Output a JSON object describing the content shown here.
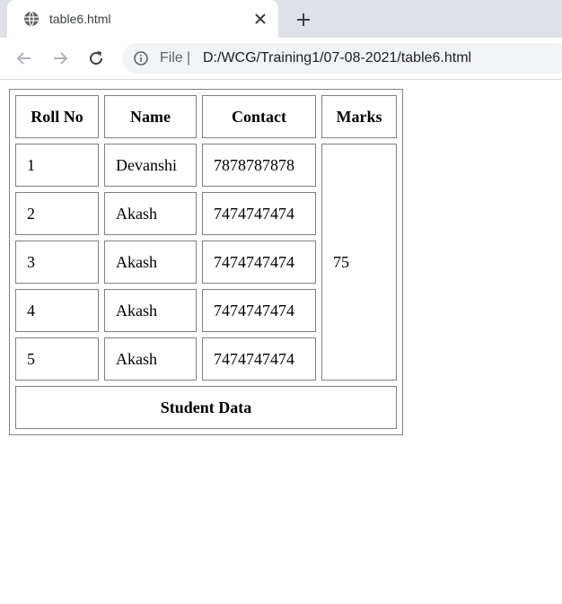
{
  "tab": {
    "title": "table6.html",
    "close_icon": "close-icon",
    "new_tab_icon": "plus-icon"
  },
  "toolbar": {
    "back_icon": "back-arrow-icon",
    "forward_icon": "forward-arrow-icon",
    "reload_icon": "reload-icon",
    "info_icon": "info-icon",
    "scheme": "File",
    "separator": "|",
    "url": "D:/WCG/Training1/07-08-2021/table6.html"
  },
  "table": {
    "headers": [
      "Roll No",
      "Name",
      "Contact",
      "Marks"
    ],
    "rows": [
      {
        "roll": "1",
        "name": "Devanshi",
        "contact": "7878787878"
      },
      {
        "roll": "2",
        "name": "Akash",
        "contact": "7474747474"
      },
      {
        "roll": "3",
        "name": "Akash",
        "contact": "7474747474"
      },
      {
        "roll": "4",
        "name": "Akash",
        "contact": "7474747474"
      },
      {
        "roll": "5",
        "name": "Akash",
        "contact": "7474747474"
      }
    ],
    "marks": "75",
    "footer": "Student Data"
  }
}
